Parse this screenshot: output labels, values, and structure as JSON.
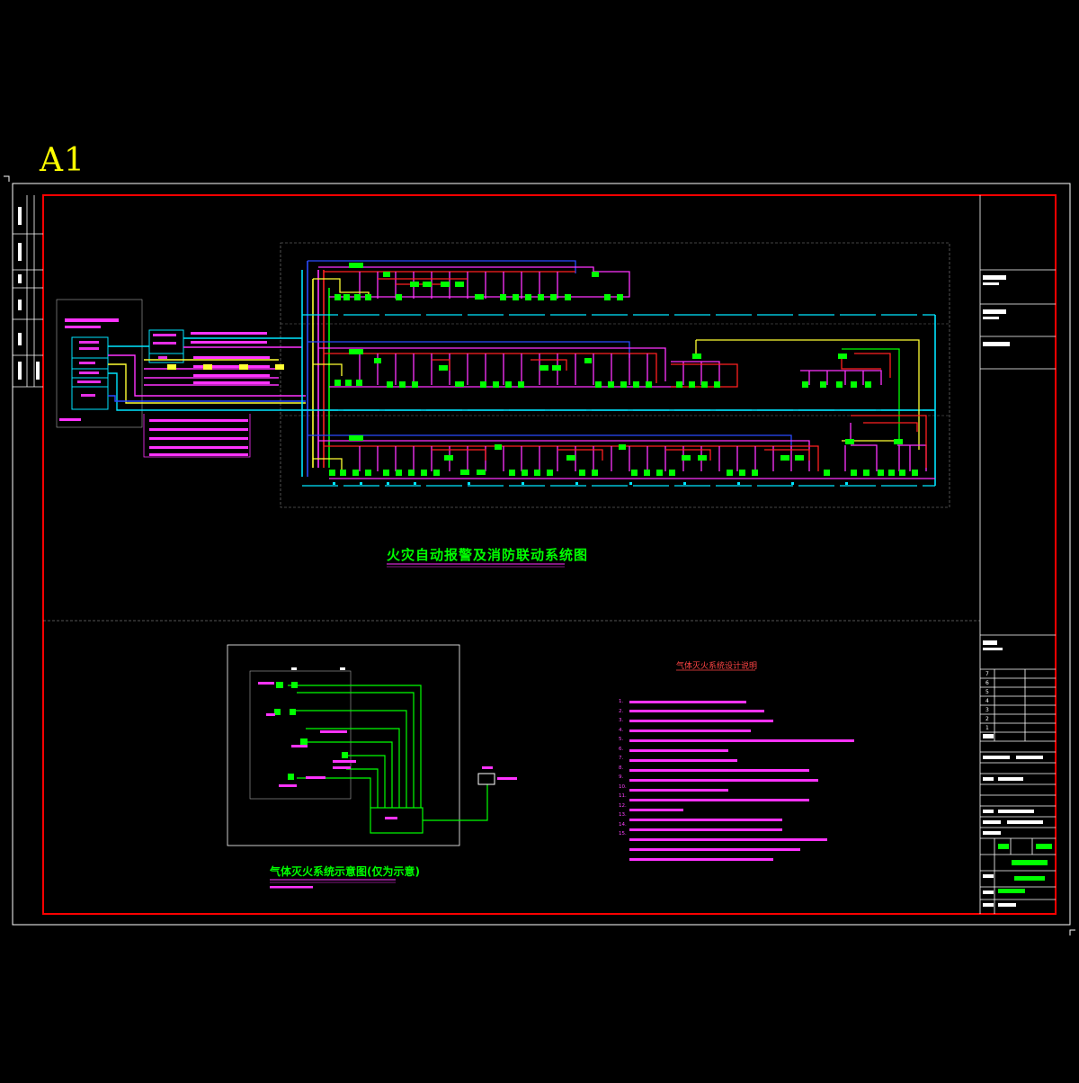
{
  "sheet": {
    "size_label": "A1",
    "colors": {
      "background": "#000000",
      "frame": "#ff0000",
      "border": "#ffffff",
      "bus_cyan": "#00e5ff",
      "bus_blue": "#2a4bff",
      "bus_magenta": "#ff33ff",
      "bus_red": "#ff2020",
      "bus_yellow": "#ffff33",
      "device_green": "#00ff00"
    }
  },
  "main_diagram": {
    "title": "火灾自动报警及消防联动系统图"
  },
  "gas_diagram": {
    "title": "气体灭火系统示意图(仅为示意)"
  },
  "notes": {
    "title": "气体灭火系统设计说明",
    "items": [
      "1.",
      "2.",
      "3.",
      "4.",
      "5.",
      "6.",
      "7.",
      "8.",
      "9.",
      "10.",
      "11.",
      "12.",
      "13.",
      "14.",
      "15."
    ]
  },
  "title_block": {
    "rev_rows": [
      "7",
      "6",
      "5",
      "4",
      "3",
      "2",
      "1"
    ]
  }
}
